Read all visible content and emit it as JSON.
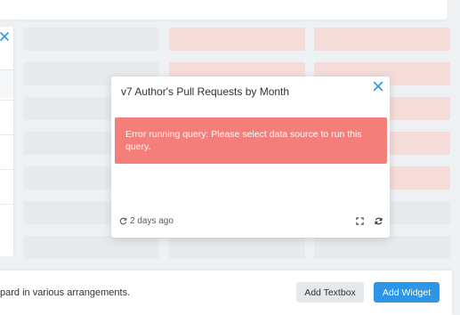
{
  "widget": {
    "title": "v7 Author's Pull Requests by Month",
    "close_icon": "close-icon",
    "error_message": "Error running query: Please select data source to run this query.",
    "updated_icon": "refresh-clock-icon",
    "updated_text": "2 days ago",
    "expand_icon": "expand-icon",
    "refresh_icon": "refresh-icon"
  },
  "bottom_bar": {
    "help_text": "pard in various arrangements.",
    "add_textbox_label": "Add Textbox",
    "add_widget_label": "Add Widget"
  },
  "colors": {
    "accent": "#2d96e6",
    "error": "#f47f7a",
    "placeholder_gray": "#e6eaec",
    "placeholder_pink": "#f6dcd8"
  }
}
